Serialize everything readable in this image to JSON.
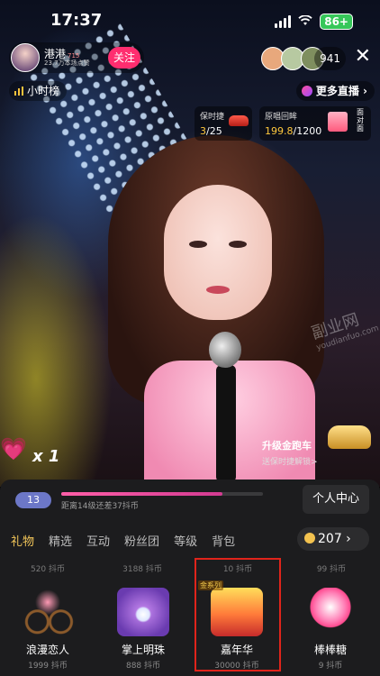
{
  "status": {
    "time": "17:37",
    "battery": "86+"
  },
  "host": {
    "name": "港港",
    "level": "715",
    "subtitle": "23.7万本场点赞",
    "follow_label": "关注"
  },
  "viewer_count": "941",
  "rank_label": "小时榜",
  "more_live_label": "更多直播",
  "cards": {
    "protect": {
      "label": "保时捷",
      "value_hl": "3",
      "value_rest": "/25"
    },
    "wish": {
      "label": "原唱回眸",
      "value_hl": "199.8",
      "value_rest": "/1200",
      "side_label": "面对面"
    }
  },
  "combo": {
    "multiplier": "x 1"
  },
  "upgrade": {
    "title": "升级金跑车",
    "subtitle": "送保时捷解锁>"
  },
  "watermark": {
    "main": "副业网",
    "sub": "youdianfuo.com"
  },
  "panel": {
    "level": "13",
    "progress": 0.8,
    "progress_note": "距离14级还差37抖币",
    "center_label": "个人中心",
    "tabs": [
      "礼物",
      "精选",
      "互动",
      "粉丝团",
      "等级",
      "背包"
    ],
    "coins": "207",
    "prev_prices": [
      "520 抖币",
      "3188 抖币",
      "10 抖币",
      "99 抖币"
    ],
    "gifts": [
      {
        "name": "浪漫恋人",
        "price": "1999 抖币"
      },
      {
        "name": "掌上明珠",
        "price": "888 抖币"
      },
      {
        "name": "嘉年华",
        "price": "30000 抖币",
        "tag": "金系列"
      },
      {
        "name": "棒棒糖",
        "price": "9 抖币"
      }
    ]
  },
  "colors": {
    "accent": "#ff2d6f",
    "gold": "#f4c75a",
    "selected_border": "#e0241b"
  }
}
